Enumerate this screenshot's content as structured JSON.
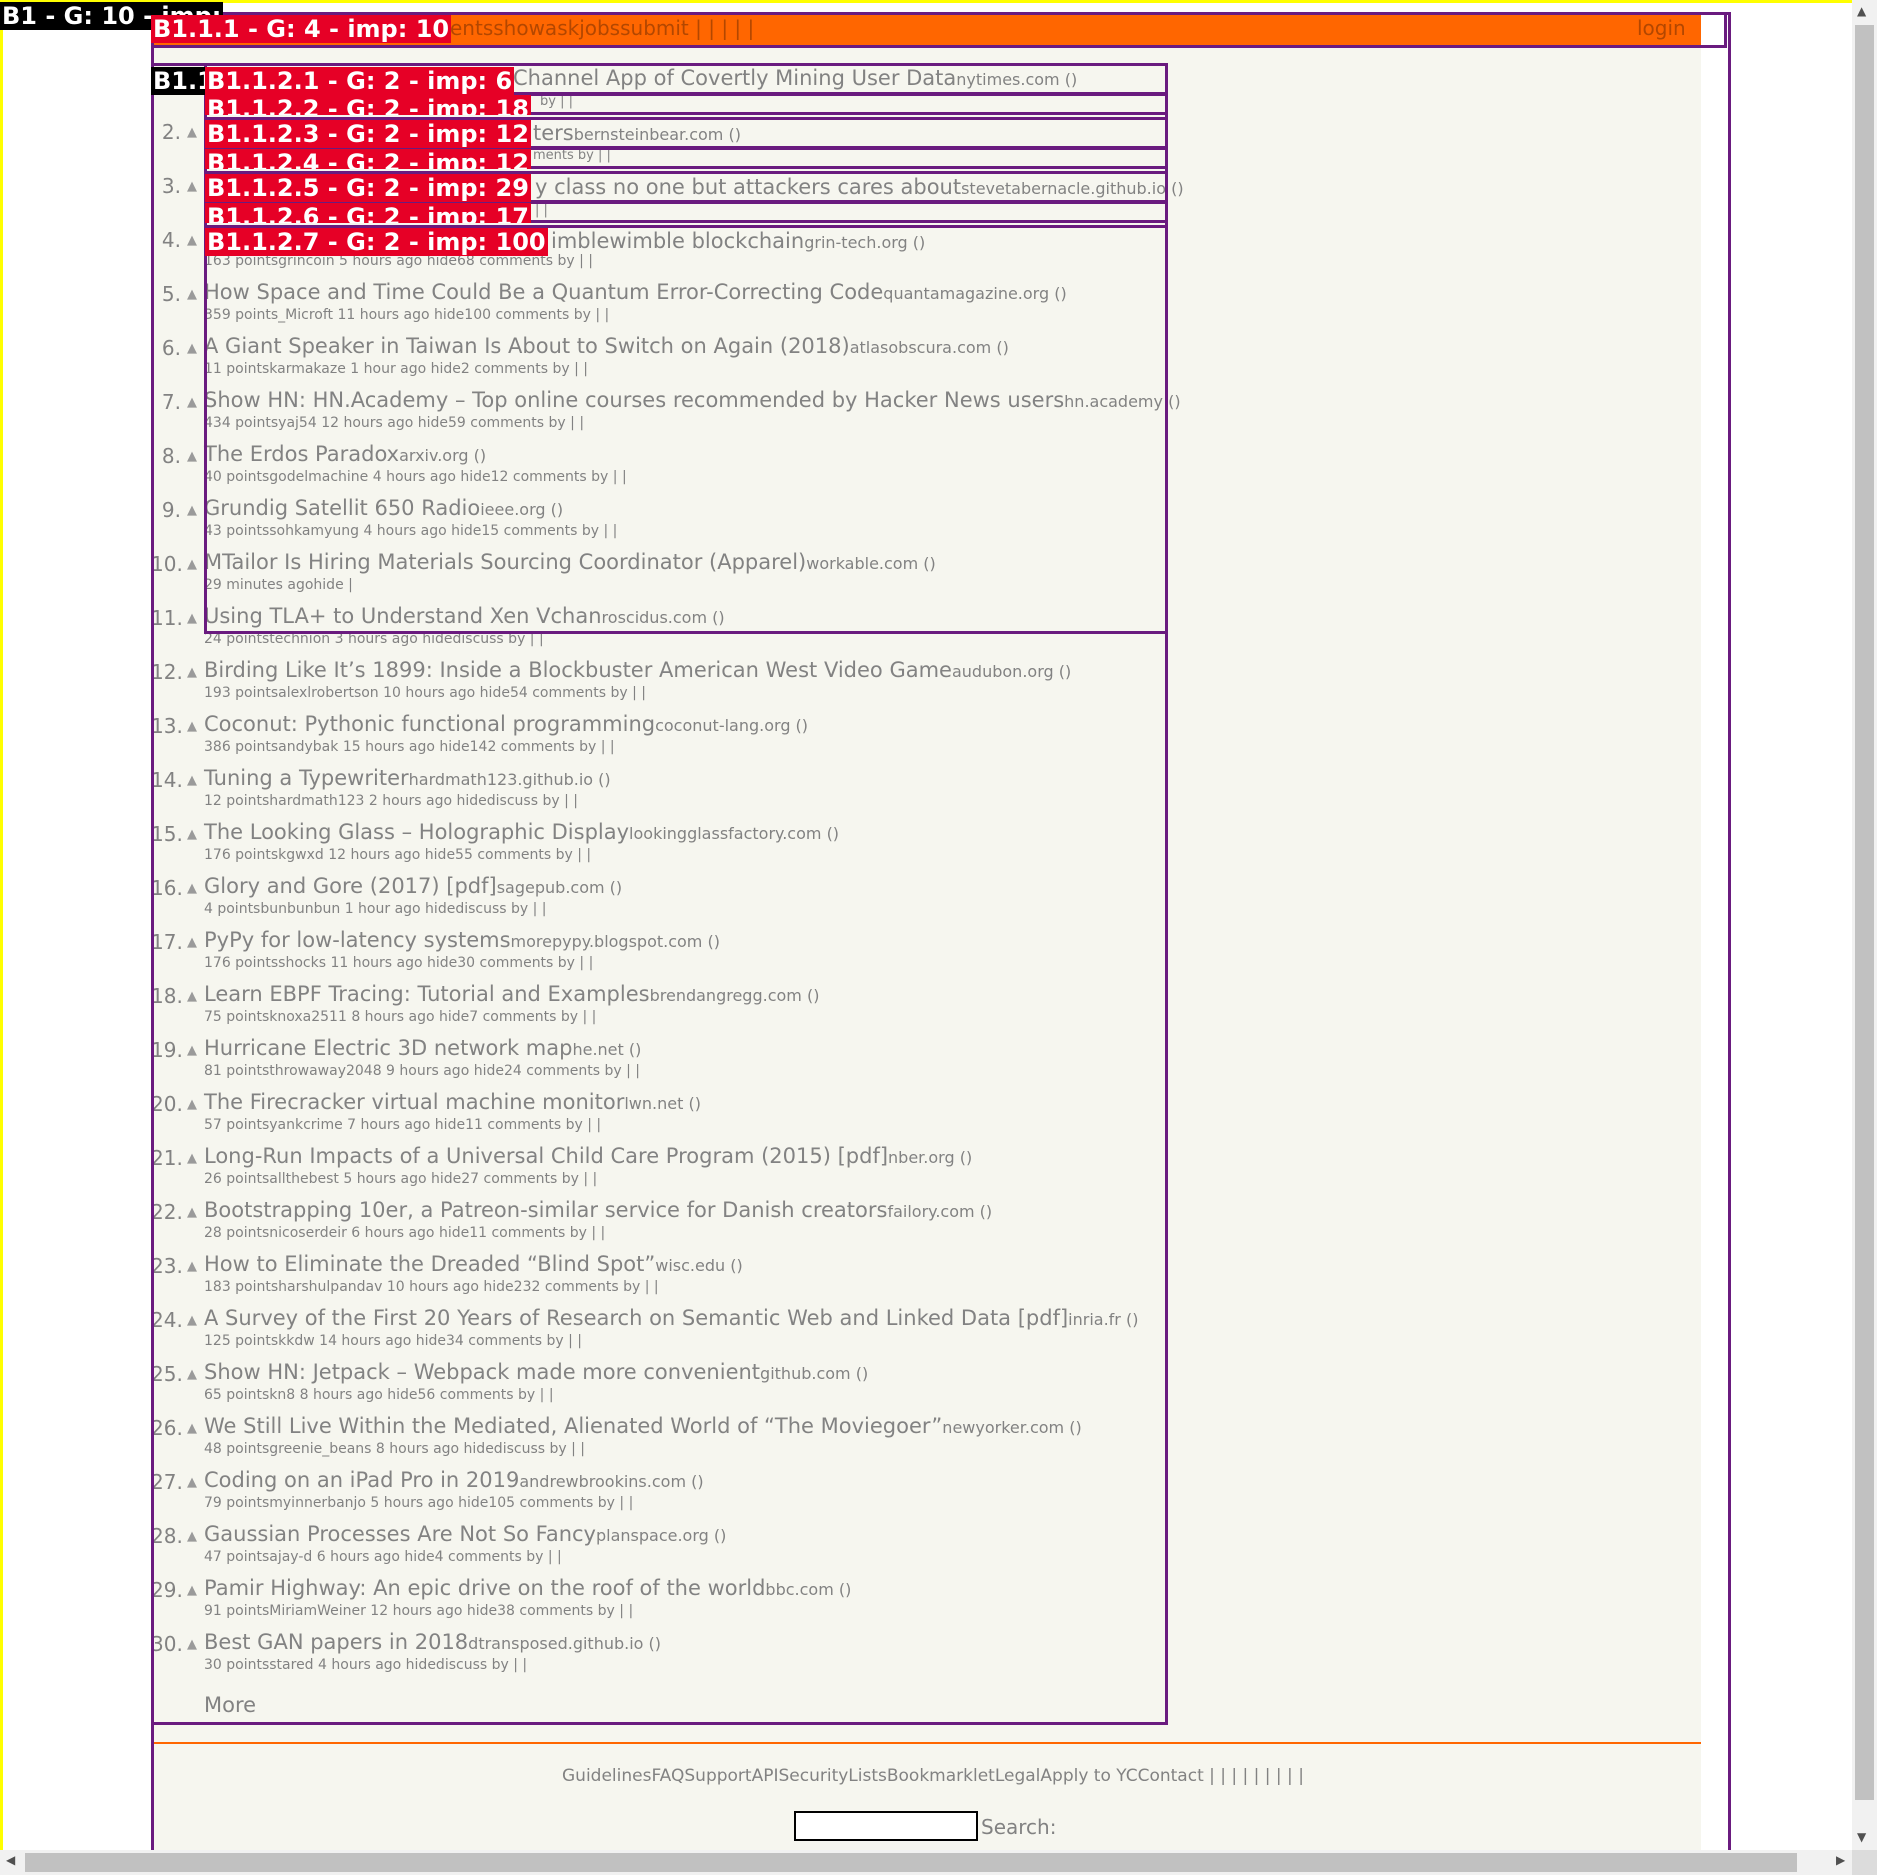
{
  "header": {
    "nav_text": "entsshowaskjobssubmit | | | | |",
    "login": "login"
  },
  "overlay_labels": {
    "b1": "B1 - G: 10 - imp:",
    "b1_1_1": "B1.1.1 - G: 4 - imp: 10",
    "b1_1_2_stub": "B1.1",
    "b1_1_2_1": "B1.1.2.1 - G: 2 - imp: 6",
    "b1_1_2_2": "B1.1.2.2 - G: 2 - imp: 18",
    "b1_1_2_3": "B1.1.2.3 - G: 2 - imp: 12",
    "b1_1_2_4": "B1.1.2.4 - G: 2 - imp: 12",
    "b1_1_2_5": "B1.1.2.5 - G: 2 - imp: 29",
    "b1_1_2_6": "B1.1.2.6 - G: 2 - imp: 17",
    "b1_1_2_7": "B1.1.2.7 - G: 2 - imp: 100"
  },
  "visible_fragments": {
    "item1_title": "Channel App of Covertly Mining User Data",
    "item1_site": "nytimes.com ()",
    "item1_sub": "by | |",
    "item2_title": "ters",
    "item2_site": "bernsteinbear.com ()",
    "item2_sub": "ments by | |",
    "item3_title": "y class no one but attackers cares about",
    "item3_site": "stevetabernacle.github.io ()",
    "item3_sub": "| |",
    "item4_title": "imblewimble blockchain",
    "item4_site": "grin-tech.org ()"
  },
  "stories": [
    {
      "rank": "2.",
      "title": "",
      "site": "",
      "sub": ""
    },
    {
      "rank": "3.",
      "title": "",
      "site": "",
      "sub": ""
    },
    {
      "rank": "4.",
      "title": "",
      "site": "",
      "sub": "163 pointsgrincoin 5 hours ago hide68 comments by | |"
    },
    {
      "rank": "5.",
      "title": "How Space and Time Could Be a Quantum Error-Correcting Code",
      "site": "quantamagazine.org ()",
      "sub": "359 points_Microft 11 hours ago hide100 comments by | |"
    },
    {
      "rank": "6.",
      "title": "A Giant Speaker in Taiwan Is About to Switch on Again (2018)",
      "site": "atlasobscura.com ()",
      "sub": "11 pointskarmakaze 1 hour ago hide2 comments by | |"
    },
    {
      "rank": "7.",
      "title": "Show HN: HN.Academy – Top online courses recommended by Hacker News users",
      "site": "hn.academy ()",
      "sub": "434 pointsyaj54 12 hours ago hide59 comments by | |"
    },
    {
      "rank": "8.",
      "title": "The Erdos Paradox",
      "site": "arxiv.org ()",
      "sub": "40 pointsgodelmachine 4 hours ago hide12 comments by | |"
    },
    {
      "rank": "9.",
      "title": "Grundig Satellit 650 Radio",
      "site": "ieee.org ()",
      "sub": "43 pointssohkamyung 4 hours ago hide15 comments by | |"
    },
    {
      "rank": "10.",
      "title": "MTailor Is Hiring Materials Sourcing Coordinator (Apparel)",
      "site": "workable.com ()",
      "sub": "29 minutes agohide |"
    },
    {
      "rank": "11.",
      "title": "Using TLA+ to Understand Xen Vchan",
      "site": "roscidus.com ()",
      "sub": "24 pointstechnion 3 hours ago hidediscuss by | |"
    },
    {
      "rank": "12.",
      "title": "Birding Like It’s 1899: Inside a Blockbuster American West Video Game",
      "site": "audubon.org ()",
      "sub": "193 pointsalexlrobertson 10 hours ago hide54 comments by | |"
    },
    {
      "rank": "13.",
      "title": "Coconut: Pythonic functional programming",
      "site": "coconut-lang.org ()",
      "sub": "386 pointsandybak 15 hours ago hide142 comments by | |"
    },
    {
      "rank": "14.",
      "title": "Tuning a Typewriter",
      "site": "hardmath123.github.io ()",
      "sub": "12 pointshardmath123 2 hours ago hidediscuss by | |"
    },
    {
      "rank": "15.",
      "title": "The Looking Glass – Holographic Display",
      "site": "lookingglassfactory.com ()",
      "sub": "176 pointskgwxd 12 hours ago hide55 comments by | |"
    },
    {
      "rank": "16.",
      "title": "Glory and Gore (2017) [pdf]",
      "site": "sagepub.com ()",
      "sub": "4 pointsbunbunbun 1 hour ago hidediscuss by | |"
    },
    {
      "rank": "17.",
      "title": "PyPy for low-latency systems",
      "site": "morepypy.blogspot.com ()",
      "sub": "176 pointsshocks 11 hours ago hide30 comments by | |"
    },
    {
      "rank": "18.",
      "title": "Learn EBPF Tracing: Tutorial and Examples",
      "site": "brendangregg.com ()",
      "sub": "75 pointsknoxa2511 8 hours ago hide7 comments by | |"
    },
    {
      "rank": "19.",
      "title": "Hurricane Electric 3D network map",
      "site": "he.net ()",
      "sub": "81 pointsthrowaway2048 9 hours ago hide24 comments by | |"
    },
    {
      "rank": "20.",
      "title": "The Firecracker virtual machine monitor",
      "site": "lwn.net ()",
      "sub": "57 pointsyankcrime 7 hours ago hide11 comments by | |"
    },
    {
      "rank": "21.",
      "title": "Long-Run Impacts of a Universal Child Care Program (2015) [pdf]",
      "site": "nber.org ()",
      "sub": "26 pointsallthebest 5 hours ago hide27 comments by | |"
    },
    {
      "rank": "22.",
      "title": "Bootstrapping 10er, a Patreon-similar service for Danish creators",
      "site": "failory.com ()",
      "sub": "28 pointsnicoserdeir 6 hours ago hide11 comments by | |"
    },
    {
      "rank": "23.",
      "title": "How to Eliminate the Dreaded “Blind Spot”",
      "site": "wisc.edu ()",
      "sub": "183 pointsharshulpandav 10 hours ago hide232 comments by | |"
    },
    {
      "rank": "24.",
      "title": "A Survey of the First 20 Years of Research on Semantic Web and Linked Data [pdf]",
      "site": "inria.fr ()",
      "sub": "125 pointskkdw 14 hours ago hide34 comments by | |"
    },
    {
      "rank": "25.",
      "title": "Show HN: Jetpack – Webpack made more convenient",
      "site": "github.com ()",
      "sub": "65 pointskn8 8 hours ago hide56 comments by | |"
    },
    {
      "rank": "26.",
      "title": "We Still Live Within the Mediated, Alienated World of “The Moviegoer”",
      "site": "newyorker.com ()",
      "sub": "48 pointsgreenie_beans 8 hours ago hidediscuss by | |"
    },
    {
      "rank": "27.",
      "title": "Coding on an iPad Pro in 2019",
      "site": "andrewbrookins.com ()",
      "sub": "79 pointsmyinnerbanjo 5 hours ago hide105 comments by | |"
    },
    {
      "rank": "28.",
      "title": "Gaussian Processes Are Not So Fancy",
      "site": "planspace.org ()",
      "sub": "47 pointsajay-d 6 hours ago hide4 comments by | |"
    },
    {
      "rank": "29.",
      "title": "Pamir Highway: An epic drive on the roof of the world",
      "site": "bbc.com ()",
      "sub": "91 pointsMiriamWeiner 12 hours ago hide38 comments by | |"
    },
    {
      "rank": "30.",
      "title": "Best GAN papers in 2018",
      "site": "dtransposed.github.io ()",
      "sub": "30 pointsstared 4 hours ago hidediscuss by | |"
    }
  ],
  "more": "More",
  "footer": {
    "links": "GuidelinesFAQSupportAPISecurityListsBookmarkletLegalApply to YCContact | | | | | | | | |",
    "search_label": "Search:"
  },
  "colors": {
    "header_bg": "#ff6600",
    "page_bg": "#f6f6ef",
    "label_red": "#e60026",
    "box_purple": "#6a1b7f"
  }
}
